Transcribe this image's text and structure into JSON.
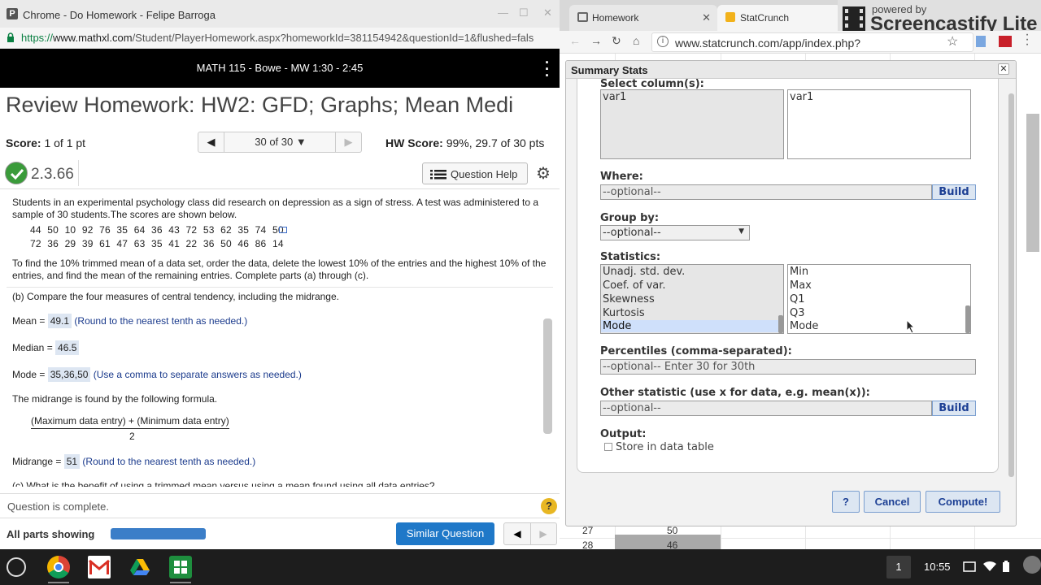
{
  "left_window": {
    "title": "Chrome - Do Homework - Felipe Barroga",
    "url_scheme": "https://",
    "url_domain": "www.mathxl.com",
    "url_path": "/Student/PlayerHomework.aspx?homeworkId=381154942&questionId=1&flushed=fals",
    "course": "MATH 115 - Bowe - MW 1:30 - 2:45",
    "hw_title": "Review Homework: HW2: GFD; Graphs; Mean Medi",
    "score_label": "Score:",
    "score_value": "1 of 1 pt",
    "nav_count": "30 of 30",
    "hw_score_label": "HW Score:",
    "hw_score_value": "99%, 29.7 of 30 pts",
    "question_number": "2.3.66",
    "question_help": "Question Help",
    "question_intro": "Students in an experimental psychology class did research on depression as a sign of stress. A test was administered to a sample of 30 students.The scores are shown below.",
    "data_row1": "44 50 10 92 76 35 64 36 43 72 53 62 35 74 50",
    "data_row2": "72 36 29 39 61 47 63 35 41 22 36 50 46 86 14",
    "trimmed_instructions": "To find the 10% trimmed mean of a data set, order the data, delete the lowest 10% of the entries and the highest 10% of the entries, and find the mean of the remaining entries. Complete parts (a) through (c).",
    "part_b": "(b) Compare the four measures of central tendency, including the midrange.",
    "mean_label": "Mean =",
    "mean_value": "49.1",
    "mean_hint": "(Round to the nearest tenth as needed.)",
    "median_label": "Median =",
    "median_value": "46.5",
    "mode_label": "Mode =",
    "mode_value": "35,36,50",
    "mode_hint": "(Use a comma to separate answers as needed.)",
    "midrange_formula_intro": "The midrange is found by the following formula.",
    "formula_numerator": "(Maximum data entry) + (Minimum data entry)",
    "formula_denominator": "2",
    "midrange_label": "Midrange =",
    "midrange_value": "51",
    "midrange_hint": "(Round to the nearest tenth as needed.)",
    "part_c_cut": "(c) What is the benefit of using a trimmed mean versus using a mean found using all data entries?",
    "question_complete": "Question is complete.",
    "help_symbol": "?",
    "all_parts": "All parts showing",
    "progress": 1.0,
    "similar_question": "Similar Question"
  },
  "right_window": {
    "tab1": "Homework",
    "tab2": "StatCrunch",
    "badge_top": "powered by",
    "badge_name": "Screencastify Lite",
    "url": "www.statcrunch.com/app/index.php?",
    "sheet_rows": [
      {
        "row": "27",
        "value": "50"
      },
      {
        "row": "28",
        "value": "46"
      }
    ]
  },
  "dialog": {
    "title": "Summary Stats",
    "select_columns_label": "Select column(s):",
    "columns_available": [
      "var1"
    ],
    "columns_selected": [
      "var1"
    ],
    "where_label": "Where:",
    "where_placeholder": "--optional--",
    "build_label": "Build",
    "group_by_label": "Group by:",
    "group_by_value": "--optional--",
    "statistics_label": "Statistics:",
    "statistics_available": [
      "Unadj. std. dev.",
      "Coef. of var.",
      "Skewness",
      "Kurtosis",
      "Mode"
    ],
    "statistics_selected": [
      "Min",
      "Max",
      "Q1",
      "Q3",
      "Mode"
    ],
    "percentiles_label": "Percentiles (comma-separated):",
    "percentiles_placeholder": "--optional-- Enter 30 for 30th",
    "other_label": "Other statistic (use x for data, e.g. mean(x)):",
    "other_placeholder": "--optional--",
    "output_label": "Output:",
    "store_label": "Store in data table",
    "help_btn": "?",
    "cancel_btn": "Cancel",
    "compute_btn": "Compute!"
  },
  "taskbar": {
    "notification_count": "1",
    "time": "10:55"
  }
}
